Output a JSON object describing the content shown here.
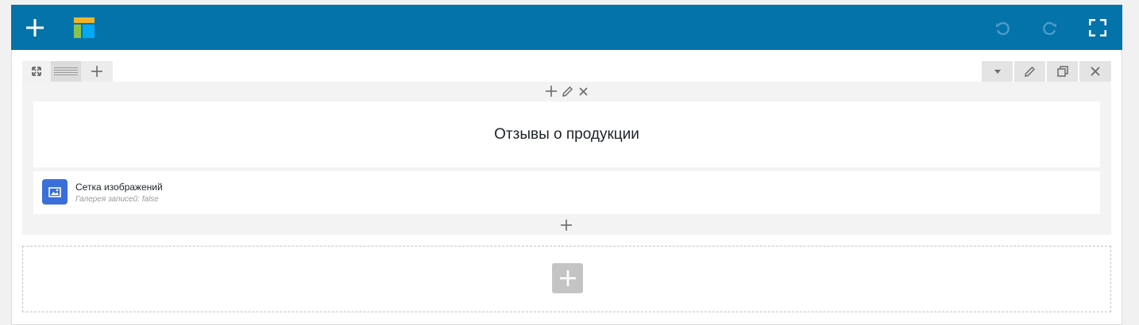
{
  "toolbar": {
    "background": "#0473aa",
    "add_icon": "plus-icon",
    "layout_icon": "layout-icon",
    "undo_icon": "undo-icon",
    "redo_icon": "redo-icon",
    "fullscreen_icon": "fullscreen-icon"
  },
  "row": {
    "tabs": [
      {
        "icon": "expand-icon"
      },
      {
        "icon": "drag-handle-icon"
      },
      {
        "icon": "plus-icon"
      }
    ],
    "controls": [
      {
        "icon": "caret-down-icon"
      },
      {
        "icon": "pencil-icon"
      },
      {
        "icon": "duplicate-icon"
      },
      {
        "icon": "close-icon"
      }
    ],
    "cell_actions": [
      {
        "icon": "plus-icon"
      },
      {
        "icon": "pencil-icon"
      },
      {
        "icon": "close-icon"
      }
    ],
    "widgets": [
      {
        "title": "Отзывы о продукции"
      },
      {
        "title": "Сетка изображений",
        "description": "Галерея записей: false",
        "icon": "image-icon",
        "icon_bg": "#3a6ed9"
      }
    ]
  },
  "new_row": {
    "icon": "plus-icon",
    "button_bg": "#c4c4c4"
  }
}
